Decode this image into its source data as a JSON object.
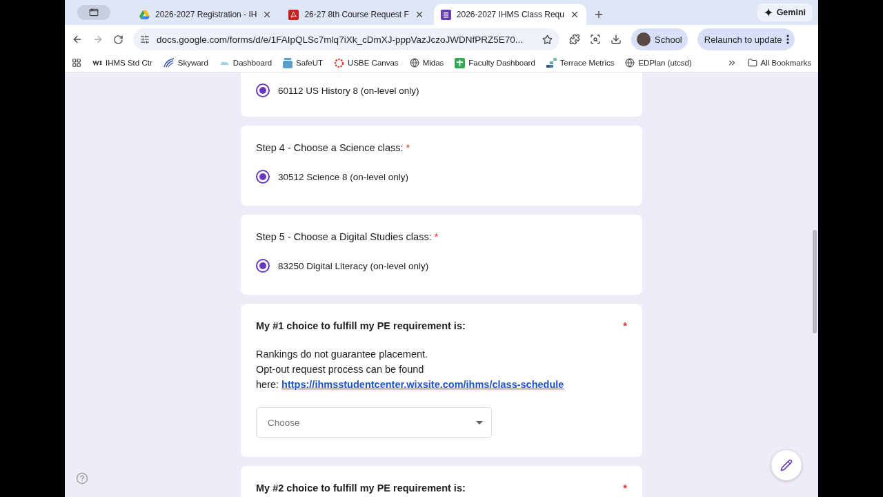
{
  "browser": {
    "tabs": [
      {
        "title": "2026-2027 Registration - IH",
        "kind": "drive",
        "selected": false
      },
      {
        "title": "26-27 8th Course Request F",
        "kind": "pdf",
        "selected": false
      },
      {
        "title": "2026-2027 IHMS Class Requ",
        "kind": "forms",
        "selected": true
      }
    ],
    "gemini": "Gemini",
    "url": "docs.google.com/forms/d/e/1FAIpQLSc7mlq7iXk_cDmXJ-pppVazJczoJWDNfPRZ5E70...",
    "profile": "School",
    "relaunch": "Relaunch to update",
    "bookmarks": [
      {
        "label": "IHMS Std Ctr",
        "kind": "wix"
      },
      {
        "label": "Skyward",
        "kind": "skyward"
      },
      {
        "label": "Dashboard",
        "kind": "dashboard"
      },
      {
        "label": "SafeUT",
        "kind": "safeut"
      },
      {
        "label": "USBE Canvas",
        "kind": "canvas"
      },
      {
        "label": "Midas",
        "kind": "globe"
      },
      {
        "label": "Faculty Dashboard",
        "kind": "sheet"
      },
      {
        "label": "Terrace Metrics",
        "kind": "metrics"
      },
      {
        "label": "EDPlan (utcsd)",
        "kind": "globe"
      }
    ],
    "all_bookmarks": "All Bookmarks"
  },
  "form": {
    "questions": [
      {
        "kind": "radio",
        "options": [
          {
            "label": "60112 US History 8 (on-level only)",
            "selected": true
          }
        ]
      },
      {
        "kind": "radio",
        "title": "Step 4 - Choose a Science class:",
        "required_mark": "*",
        "options": [
          {
            "label": "30512 Science 8 (on-level only)",
            "selected": true
          }
        ]
      },
      {
        "kind": "radio",
        "title": "Step 5 - Choose a Digital Studies class:",
        "required_mark": "*",
        "options": [
          {
            "label": "83250 Digital Literacy (on-level only)",
            "selected": true
          }
        ]
      },
      {
        "kind": "dropdown",
        "title": "My #1 choice to fulfill my PE requirement is:",
        "required_mark": "*",
        "description": [
          "Rankings do not guarantee placement.",
          "Opt-out request process can be found\nhere:"
        ],
        "link": "https://ihmsstudentcenter.wixsite.com/ihms/class-schedule",
        "placeholder": "Choose"
      },
      {
        "kind": "dropdown",
        "title": "My #2 choice to fulfill my PE requirement is:",
        "required_mark": "*"
      }
    ]
  }
}
